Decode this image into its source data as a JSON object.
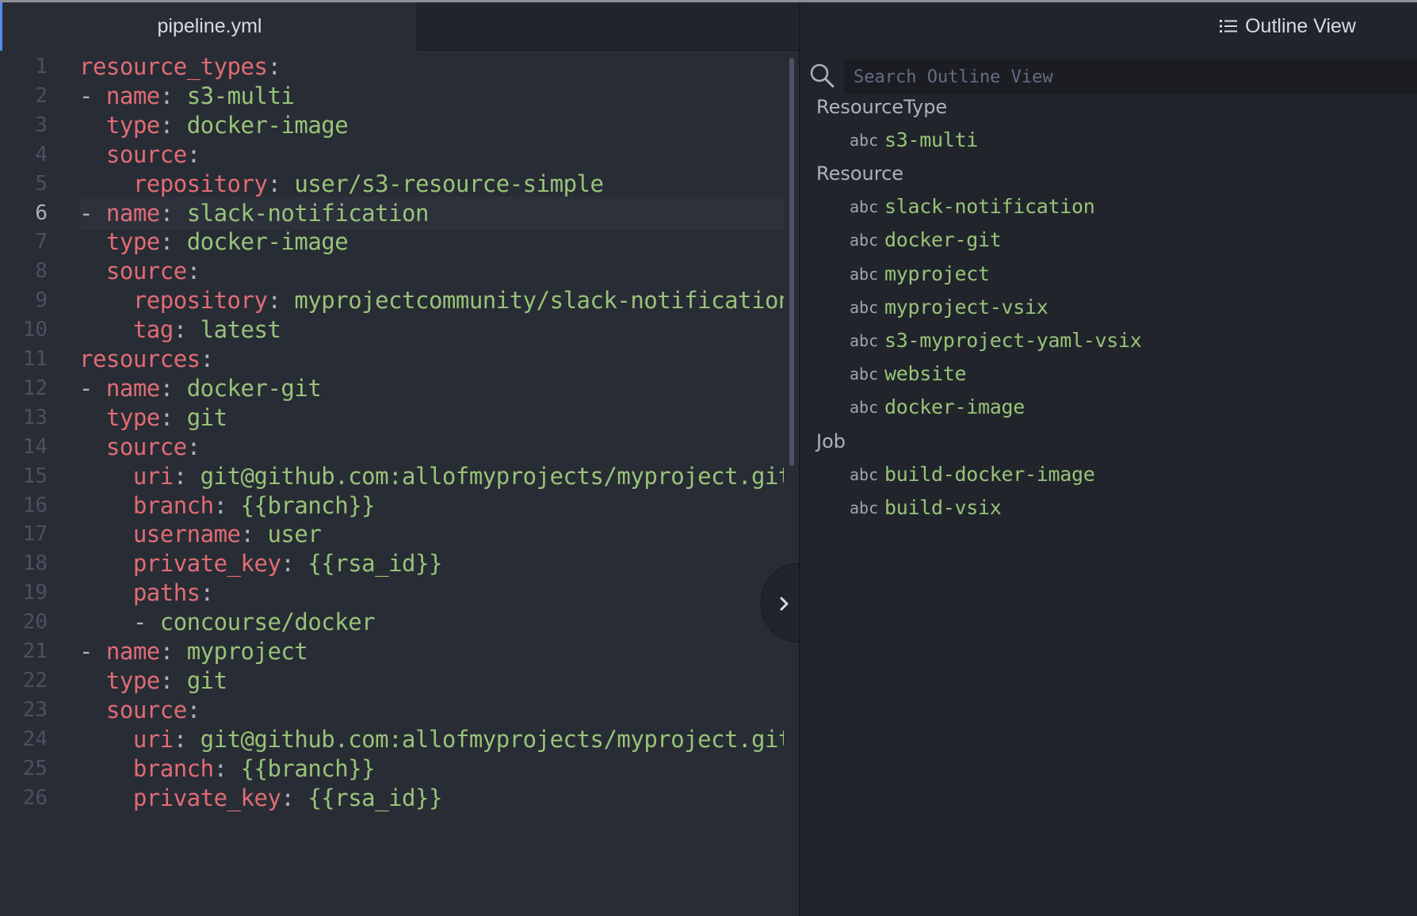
{
  "editor": {
    "tab_title": "pipeline.yml",
    "active_line": 6,
    "lines": [
      {
        "num": "1",
        "tokens": [
          {
            "t": "resource_types",
            "c": "k"
          },
          {
            "t": ":",
            "c": "p"
          }
        ]
      },
      {
        "num": "2",
        "tokens": [
          {
            "t": "- ",
            "c": "p"
          },
          {
            "t": "name",
            "c": "k"
          },
          {
            "t": ": ",
            "c": "p"
          },
          {
            "t": "s3-multi",
            "c": "v"
          }
        ]
      },
      {
        "num": "3",
        "tokens": [
          {
            "t": "  ",
            "c": "p"
          },
          {
            "t": "type",
            "c": "k"
          },
          {
            "t": ": ",
            "c": "p"
          },
          {
            "t": "docker-image",
            "c": "v"
          }
        ]
      },
      {
        "num": "4",
        "tokens": [
          {
            "t": "  ",
            "c": "p"
          },
          {
            "t": "source",
            "c": "k"
          },
          {
            "t": ":",
            "c": "p"
          }
        ]
      },
      {
        "num": "5",
        "tokens": [
          {
            "t": "    ",
            "c": "p"
          },
          {
            "t": "repository",
            "c": "k"
          },
          {
            "t": ": ",
            "c": "p"
          },
          {
            "t": "user/s3-resource-simple",
            "c": "v"
          }
        ]
      },
      {
        "num": "6",
        "tokens": [
          {
            "t": "- ",
            "c": "p"
          },
          {
            "t": "name",
            "c": "k"
          },
          {
            "t": ": ",
            "c": "p"
          },
          {
            "t": "slack-notification",
            "c": "v"
          }
        ]
      },
      {
        "num": "7",
        "tokens": [
          {
            "t": "  ",
            "c": "p"
          },
          {
            "t": "type",
            "c": "k"
          },
          {
            "t": ": ",
            "c": "p"
          },
          {
            "t": "docker-image",
            "c": "v"
          }
        ]
      },
      {
        "num": "8",
        "tokens": [
          {
            "t": "  ",
            "c": "p"
          },
          {
            "t": "source",
            "c": "k"
          },
          {
            "t": ":",
            "c": "p"
          }
        ]
      },
      {
        "num": "9",
        "tokens": [
          {
            "t": "    ",
            "c": "p"
          },
          {
            "t": "repository",
            "c": "k"
          },
          {
            "t": ": ",
            "c": "p"
          },
          {
            "t": "myprojectcommunity/slack-notification-resource",
            "c": "v"
          }
        ]
      },
      {
        "num": "10",
        "tokens": [
          {
            "t": "    ",
            "c": "p"
          },
          {
            "t": "tag",
            "c": "k"
          },
          {
            "t": ": ",
            "c": "p"
          },
          {
            "t": "latest",
            "c": "v"
          }
        ]
      },
      {
        "num": "11",
        "tokens": [
          {
            "t": "resources",
            "c": "k"
          },
          {
            "t": ":",
            "c": "p"
          }
        ]
      },
      {
        "num": "12",
        "tokens": [
          {
            "t": "- ",
            "c": "p"
          },
          {
            "t": "name",
            "c": "k"
          },
          {
            "t": ": ",
            "c": "p"
          },
          {
            "t": "docker-git",
            "c": "v"
          }
        ]
      },
      {
        "num": "13",
        "tokens": [
          {
            "t": "  ",
            "c": "p"
          },
          {
            "t": "type",
            "c": "k"
          },
          {
            "t": ": ",
            "c": "p"
          },
          {
            "t": "git",
            "c": "v"
          }
        ]
      },
      {
        "num": "14",
        "tokens": [
          {
            "t": "  ",
            "c": "p"
          },
          {
            "t": "source",
            "c": "k"
          },
          {
            "t": ":",
            "c": "p"
          }
        ]
      },
      {
        "num": "15",
        "tokens": [
          {
            "t": "    ",
            "c": "p"
          },
          {
            "t": "uri",
            "c": "k"
          },
          {
            "t": ": ",
            "c": "p"
          },
          {
            "t": "git@github.com:allofmyprojects/myproject.git",
            "c": "v"
          }
        ]
      },
      {
        "num": "16",
        "tokens": [
          {
            "t": "    ",
            "c": "p"
          },
          {
            "t": "branch",
            "c": "k"
          },
          {
            "t": ": ",
            "c": "p"
          },
          {
            "t": "{{branch}}",
            "c": "v"
          }
        ]
      },
      {
        "num": "17",
        "tokens": [
          {
            "t": "    ",
            "c": "p"
          },
          {
            "t": "username",
            "c": "k"
          },
          {
            "t": ": ",
            "c": "p"
          },
          {
            "t": "user",
            "c": "v"
          }
        ]
      },
      {
        "num": "18",
        "tokens": [
          {
            "t": "    ",
            "c": "p"
          },
          {
            "t": "private_key",
            "c": "k"
          },
          {
            "t": ": ",
            "c": "p"
          },
          {
            "t": "{{rsa_id}}",
            "c": "v"
          }
        ]
      },
      {
        "num": "19",
        "tokens": [
          {
            "t": "    ",
            "c": "p"
          },
          {
            "t": "paths",
            "c": "k"
          },
          {
            "t": ":",
            "c": "p"
          }
        ]
      },
      {
        "num": "20",
        "tokens": [
          {
            "t": "    - ",
            "c": "p"
          },
          {
            "t": "concourse/docker",
            "c": "v"
          }
        ]
      },
      {
        "num": "21",
        "tokens": [
          {
            "t": "- ",
            "c": "p"
          },
          {
            "t": "name",
            "c": "k"
          },
          {
            "t": ": ",
            "c": "p"
          },
          {
            "t": "myproject",
            "c": "v"
          }
        ]
      },
      {
        "num": "22",
        "tokens": [
          {
            "t": "  ",
            "c": "p"
          },
          {
            "t": "type",
            "c": "k"
          },
          {
            "t": ": ",
            "c": "p"
          },
          {
            "t": "git",
            "c": "v"
          }
        ]
      },
      {
        "num": "23",
        "tokens": [
          {
            "t": "  ",
            "c": "p"
          },
          {
            "t": "source",
            "c": "k"
          },
          {
            "t": ":",
            "c": "p"
          }
        ]
      },
      {
        "num": "24",
        "tokens": [
          {
            "t": "    ",
            "c": "p"
          },
          {
            "t": "uri",
            "c": "k"
          },
          {
            "t": ": ",
            "c": "p"
          },
          {
            "t": "git@github.com:allofmyprojects/myproject.git",
            "c": "v"
          }
        ]
      },
      {
        "num": "25",
        "tokens": [
          {
            "t": "    ",
            "c": "p"
          },
          {
            "t": "branch",
            "c": "k"
          },
          {
            "t": ": ",
            "c": "p"
          },
          {
            "t": "{{branch}}",
            "c": "v"
          }
        ]
      },
      {
        "num": "26",
        "tokens": [
          {
            "t": "    ",
            "c": "p"
          },
          {
            "t": "private_key",
            "c": "k"
          },
          {
            "t": ": ",
            "c": "p"
          },
          {
            "t": "{{rsa_id}}",
            "c": "v"
          }
        ]
      }
    ]
  },
  "outline": {
    "title": "Outline View",
    "search_placeholder": "Search Outline View",
    "kind_label": "abc",
    "groups": [
      {
        "label": "ResourceType",
        "items": [
          "s3-multi"
        ]
      },
      {
        "label": "Resource",
        "items": [
          "slack-notification",
          "docker-git",
          "myproject",
          "myproject-vsix",
          "s3-myproject-yaml-vsix",
          "website",
          "docker-image"
        ]
      },
      {
        "label": "Job",
        "items": [
          "build-docker-image",
          "build-vsix"
        ]
      }
    ]
  },
  "colors": {
    "background": "#282c34",
    "panel": "#21252b",
    "key": "#e06c75",
    "value": "#98c379",
    "punctuation": "#abb2bf",
    "accent": "#568af2"
  },
  "icons": {
    "outline": "list-icon",
    "search": "search-icon",
    "toggle": "chevron-right-icon"
  }
}
